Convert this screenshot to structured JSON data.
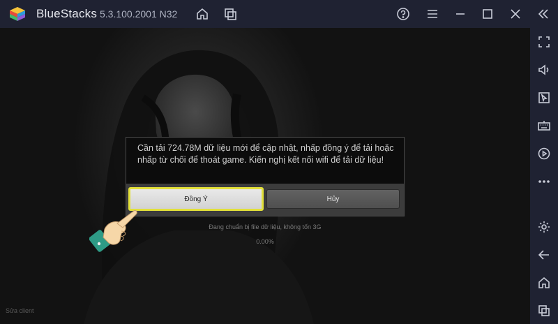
{
  "titlebar": {
    "app_name": "BlueStacks",
    "version": "5.3.100.2001 N32",
    "icons": [
      "home-icon",
      "multi-instance-icon",
      "help-icon",
      "menu-icon",
      "minimize-icon",
      "maximize-icon",
      "close-icon",
      "collapse-sidebar-icon"
    ]
  },
  "sidebar": {
    "icons": [
      "fullscreen-icon",
      "volume-icon",
      "pointer-icon",
      "keyboard-icon",
      "record-icon",
      "more-icon",
      "settings-icon",
      "back-icon",
      "home-icon",
      "recent-apps-icon"
    ]
  },
  "game": {
    "loading_text": "Đang chuẩn bị file dữ liệu, không tốn 3G",
    "loading_percent": "0.00%",
    "bottom_label": "Sửa client"
  },
  "dialog": {
    "message": "Cần tải 724.78M dữ liệu mới để cập nhật, nhấp đồng ý để tải hoặc nhấp từ chối để thoát game. Kiến nghị kết nối wifi để tải dữ liệu!",
    "confirm_label": "Đồng Ý",
    "cancel_label": "Hủy"
  },
  "colors": {
    "titlebar_bg": "#1f2232",
    "highlight": "#e2e03a",
    "hand_skin": "#f6d7a8",
    "cuff": "#2e9b86"
  }
}
